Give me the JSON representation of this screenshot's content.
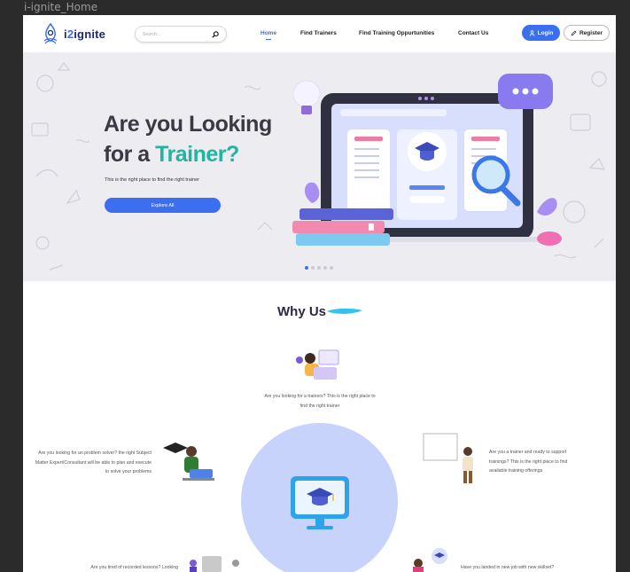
{
  "window": {
    "title": "i-ignite_Home"
  },
  "header": {
    "logo_text_a": "i",
    "logo_text_b": "2",
    "logo_text_c": "ignite",
    "search_placeholder": "Search...",
    "nav": [
      "Home",
      "Find Trainers",
      "Find Training Oppurtunities",
      "Contact Us"
    ],
    "active_nav": "Home",
    "login_label": "Login",
    "register_label": "Register"
  },
  "hero": {
    "title_line1": "Are you Looking",
    "title_line2_a": "for a ",
    "title_line2_b": "Trainer?",
    "subtitle": "This is the right place to find the right trainer",
    "cta_label": "Explore All",
    "slide_count": 5,
    "active_slide": 1
  },
  "why_us": {
    "title": "Why Us",
    "features": {
      "top": "Are you looking for a trainers? This is the right place to find the right trainer",
      "left": "Are you looking for an problem solver? the right Subject Matter Expert/Consultant will be able to plan and execute to solve your problems",
      "right": "Are you a trainer and ready to support trainings? This is the right place to find available training offerings",
      "bottom_left": "Are you tired of recorded lessons? Looking",
      "bottom_right": "Have you landed in new job with new skillset?"
    }
  },
  "colors": {
    "primary": "#3b6ff0",
    "accent": "#1fb5a0",
    "hero_bg": "#ececf1",
    "circle": "#c7d3fb"
  }
}
